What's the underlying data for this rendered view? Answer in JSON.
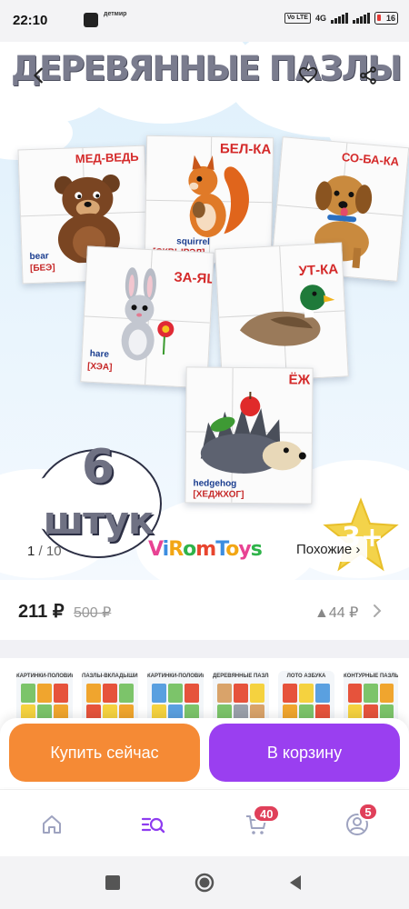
{
  "status_bar": {
    "time": "22:10",
    "brand": "детмир",
    "volte": "Vo LTE",
    "network": "4G",
    "battery": "16"
  },
  "hero": {
    "title": "ДЕРЕВЯННЫЕ ПАЗЛЫ",
    "cards": [
      {
        "ru": "МЕД-ВЕДЬ",
        "en": "bear",
        "tr": "[БЕЭ]"
      },
      {
        "ru": "БЕЛ-КА",
        "en": "squirrel",
        "tr": "[СКВЫРЭЛ]"
      },
      {
        "ru": "СО-БА-КА",
        "en": "",
        "tr": ""
      },
      {
        "ru": "ЗА-ЯЦ",
        "en": "hare",
        "tr": "[ХЭА]"
      },
      {
        "ru": "УТ-КА",
        "en": "",
        "tr": ""
      },
      {
        "ru": "ЁЖ",
        "en": "hedgehog",
        "tr": "[ХЕДЖХОГ]"
      }
    ],
    "badge_number": "6",
    "badge_word": "штук",
    "age_badge": "3+",
    "counter_current": "1",
    "counter_total": "10",
    "logo": "ViromToys",
    "similar_label": "Похожие ›"
  },
  "price": {
    "current": "211 ₽",
    "old": "500 ₽",
    "delta": "▲44 ₽"
  },
  "thumbnails": [
    {
      "title": "КАРТИНКИ-ПОЛОВИНКИ «ОВОЩИ»"
    },
    {
      "title": "ПАЗЛЫ-ВКЛАДЫШИ ИЗ ДЕРЕВА"
    },
    {
      "title": "КАРТИНКИ-ПОЛОВИНКИ «ТРАНСПОРТ»"
    },
    {
      "title": "ДЕРЕВЯННЫЕ ПАЗЛЫ «ЖИВОТНЫЕ»"
    },
    {
      "title": "ЛОТО АЗБУКА"
    },
    {
      "title": "КОНТУРНЫЕ ПАЗЛЫ «РЕПКА»"
    }
  ],
  "actions": {
    "buy_now": "Купить сейчас",
    "add_to_cart": "В корзину"
  },
  "bottom_nav": {
    "cart_badge": "40",
    "profile_badge": "5"
  },
  "colors": {
    "buy": "#f58a35",
    "cart": "#9a3ff0",
    "active_tab": "#8e3cf0",
    "badge": "#e0405a"
  },
  "icons": [
    "back-arrow-icon",
    "heart-icon",
    "share-icon",
    "chevron-right-icon",
    "home-icon",
    "catalog-search-icon",
    "cart-icon",
    "profile-icon",
    "square-icon",
    "circle-icon",
    "triangle-back-icon"
  ]
}
